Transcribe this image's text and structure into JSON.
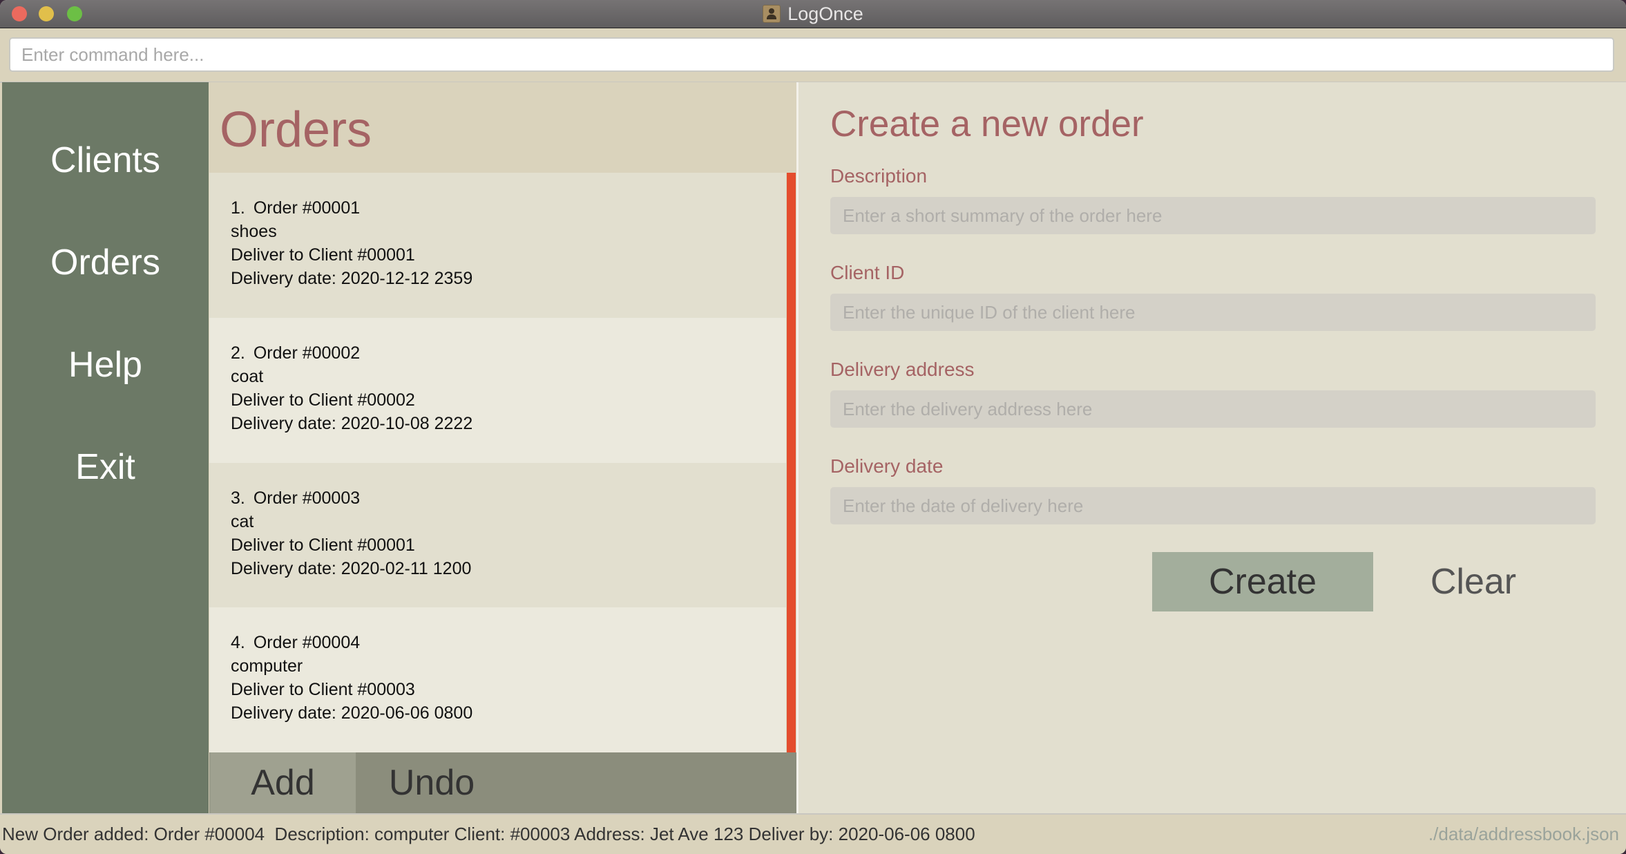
{
  "window": {
    "title": "LogOnce",
    "app_icon": "contacts-person-icon"
  },
  "command": {
    "placeholder": "Enter command here...",
    "value": ""
  },
  "sidebar": {
    "items": [
      {
        "label": "Clients"
      },
      {
        "label": "Orders"
      },
      {
        "label": "Help"
      },
      {
        "label": "Exit"
      }
    ]
  },
  "orders": {
    "title": "Orders",
    "items": [
      {
        "index": "1.",
        "title": "Order #00001",
        "description": "shoes",
        "client": "Deliver to Client #00001",
        "date": "Delivery date: 2020-12-12 2359"
      },
      {
        "index": "2.",
        "title": "Order #00002",
        "description": "coat",
        "client": "Deliver to Client #00002",
        "date": "Delivery date: 2020-10-08 2222"
      },
      {
        "index": "3.",
        "title": "Order #00003",
        "description": "cat",
        "client": "Deliver to Client #00001",
        "date": "Delivery date: 2020-02-11 1200"
      },
      {
        "index": "4.",
        "title": "Order #00004",
        "description": "computer",
        "client": "Deliver to Client #00003",
        "date": "Delivery date: 2020-06-06 0800"
      }
    ],
    "add_label": "Add",
    "undo_label": "Undo"
  },
  "form": {
    "title": "Create a new order",
    "fields": [
      {
        "label": "Description",
        "placeholder": "Enter a short summary of the order here",
        "value": ""
      },
      {
        "label": "Client ID",
        "placeholder": "Enter the unique ID of the client here",
        "value": ""
      },
      {
        "label": "Delivery address",
        "placeholder": "Enter the delivery address here",
        "value": ""
      },
      {
        "label": "Delivery date",
        "placeholder": "Enter the date of delivery here",
        "value": ""
      }
    ],
    "create_label": "Create",
    "clear_label": "Clear"
  },
  "status": {
    "message": "New Order added: Order #00004  Description: computer Client: #00003 Address: Jet Ave 123 Deliver by: 2020-06-06 0800",
    "file_path": "./data/addressbook.json"
  },
  "colors": {
    "accent_title": "#a56364",
    "sidebar": "#6c7966",
    "scrollbar_thumb": "#e44d2e",
    "create_button": "#a3ae9c"
  }
}
